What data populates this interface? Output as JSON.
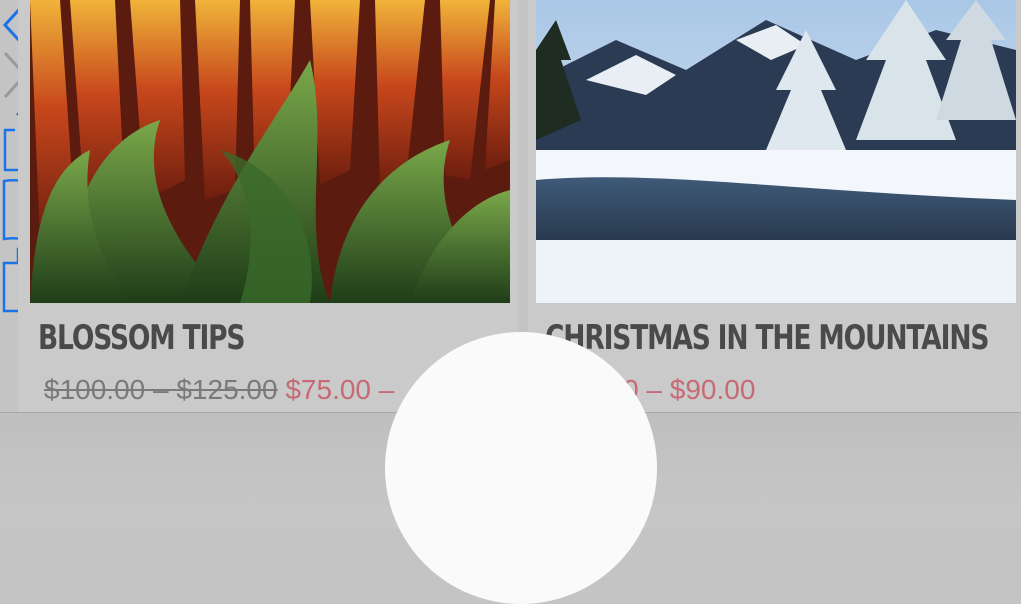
{
  "products": [
    {
      "title": "BLOSSOM TIPS",
      "price_old_1": "$100.00",
      "price_sep_old": " – ",
      "price_old_2": "$125.00",
      "price_new": " $75.00 –",
      "image": "blossom-photo"
    },
    {
      "title": "CHRISTMAS IN THE MOUNTAINS",
      "price_new": "$60.00 – $90.00",
      "image": "mountains-photo"
    }
  ],
  "toolbar": {
    "buttons": [
      "back-icon",
      "forward-icon",
      "share-icon",
      "bookmarks-icon",
      "tabs-icon"
    ]
  },
  "colors": {
    "accent": "#1a73e8",
    "sale": "#c66a75",
    "title": "#4a4a4a"
  }
}
